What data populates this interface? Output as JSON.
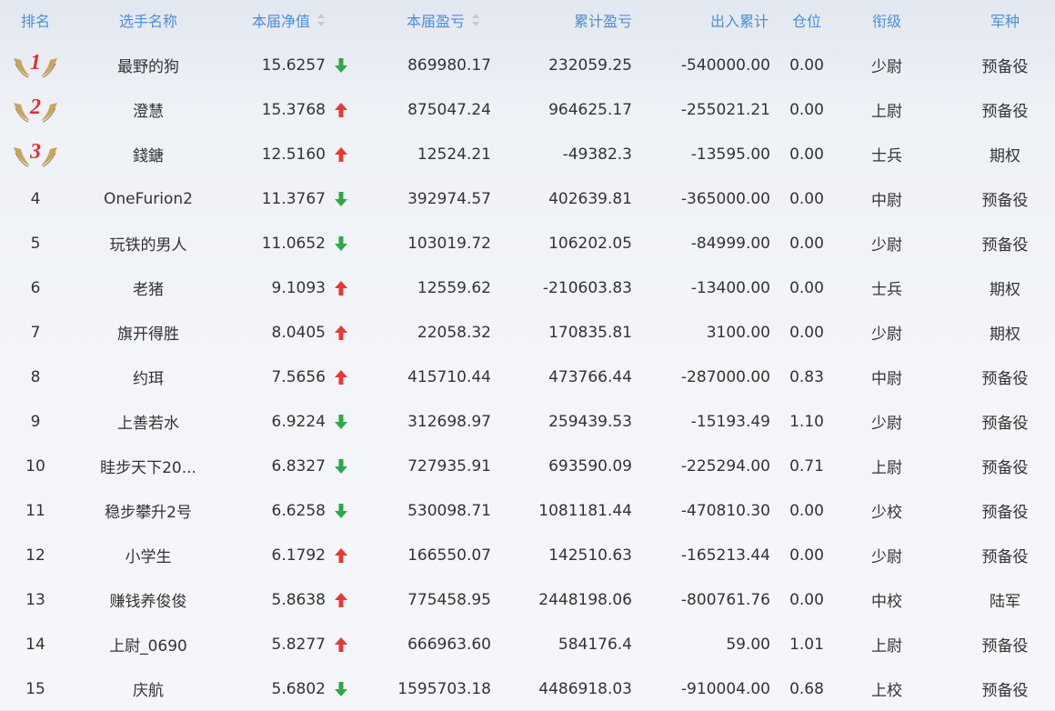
{
  "headers": {
    "rank": "排名",
    "name": "选手名称",
    "nav": "本届净值",
    "pnl": "本届盈亏",
    "cum": "累计盈亏",
    "flow": "出入累计",
    "position": "仓位",
    "grade": "衔级",
    "type": "军种"
  },
  "colors": {
    "up": "#e53935",
    "down": "#2ea84a",
    "header": "#4a8fd8"
  },
  "rows": [
    {
      "rank": "1",
      "name": "最野的狗",
      "nav": "15.6257",
      "trend": "down",
      "pnl": "869980.17",
      "cum": "232059.25",
      "flow": "-540000.00",
      "position": "0.00",
      "grade": "少尉",
      "type": "预备役"
    },
    {
      "rank": "2",
      "name": "澄慧",
      "nav": "15.3768",
      "trend": "up",
      "pnl": "875047.24",
      "cum": "964625.17",
      "flow": "-255021.21",
      "position": "0.00",
      "grade": "上尉",
      "type": "预备役"
    },
    {
      "rank": "3",
      "name": "錢鎕",
      "nav": "12.5160",
      "trend": "up",
      "pnl": "12524.21",
      "cum": "-49382.3",
      "flow": "-13595.00",
      "position": "0.00",
      "grade": "士兵",
      "type": "期权"
    },
    {
      "rank": "4",
      "name": "OneFurion2",
      "nav": "11.3767",
      "trend": "down",
      "pnl": "392974.57",
      "cum": "402639.81",
      "flow": "-365000.00",
      "position": "0.00",
      "grade": "中尉",
      "type": "预备役"
    },
    {
      "rank": "5",
      "name": "玩铁的男人",
      "nav": "11.0652",
      "trend": "down",
      "pnl": "103019.72",
      "cum": "106202.05",
      "flow": "-84999.00",
      "position": "0.00",
      "grade": "少尉",
      "type": "预备役"
    },
    {
      "rank": "6",
      "name": "老猪",
      "nav": "9.1093",
      "trend": "up",
      "pnl": "12559.62",
      "cum": "-210603.83",
      "flow": "-13400.00",
      "position": "0.00",
      "grade": "士兵",
      "type": "期权"
    },
    {
      "rank": "7",
      "name": "旗开得胜",
      "nav": "8.0405",
      "trend": "up",
      "pnl": "22058.32",
      "cum": "170835.81",
      "flow": "3100.00",
      "position": "0.00",
      "grade": "少尉",
      "type": "期权"
    },
    {
      "rank": "8",
      "name": "约珥",
      "nav": "7.5656",
      "trend": "up",
      "pnl": "415710.44",
      "cum": "473766.44",
      "flow": "-287000.00",
      "position": "0.83",
      "grade": "中尉",
      "type": "预备役"
    },
    {
      "rank": "9",
      "name": "上善若水",
      "nav": "6.9224",
      "trend": "down",
      "pnl": "312698.97",
      "cum": "259439.53",
      "flow": "-15193.49",
      "position": "1.10",
      "grade": "少尉",
      "type": "预备役"
    },
    {
      "rank": "10",
      "name": "眭步天下20...",
      "nav": "6.8327",
      "trend": "down",
      "pnl": "727935.91",
      "cum": "693590.09",
      "flow": "-225294.00",
      "position": "0.71",
      "grade": "上尉",
      "type": "预备役"
    },
    {
      "rank": "11",
      "name": "稳步攀升2号",
      "nav": "6.6258",
      "trend": "down",
      "pnl": "530098.71",
      "cum": "1081181.44",
      "flow": "-470810.30",
      "position": "0.00",
      "grade": "少校",
      "type": "预备役"
    },
    {
      "rank": "12",
      "name": "小学生",
      "nav": "6.1792",
      "trend": "up",
      "pnl": "166550.07",
      "cum": "142510.63",
      "flow": "-165213.44",
      "position": "0.00",
      "grade": "少尉",
      "type": "预备役"
    },
    {
      "rank": "13",
      "name": "赚钱养俊俊",
      "nav": "5.8638",
      "trend": "up",
      "pnl": "775458.95",
      "cum": "2448198.06",
      "flow": "-800761.76",
      "position": "0.00",
      "grade": "中校",
      "type": "陆军"
    },
    {
      "rank": "14",
      "name": "上尉_0690",
      "nav": "5.8277",
      "trend": "up",
      "pnl": "666963.60",
      "cum": "584176.4",
      "flow": "59.00",
      "position": "1.01",
      "grade": "上尉",
      "type": "预备役"
    },
    {
      "rank": "15",
      "name": "庆航",
      "nav": "5.6802",
      "trend": "down",
      "pnl": "1595703.18",
      "cum": "4486918.03",
      "flow": "-910004.00",
      "position": "0.68",
      "grade": "上校",
      "type": "预备役"
    }
  ]
}
